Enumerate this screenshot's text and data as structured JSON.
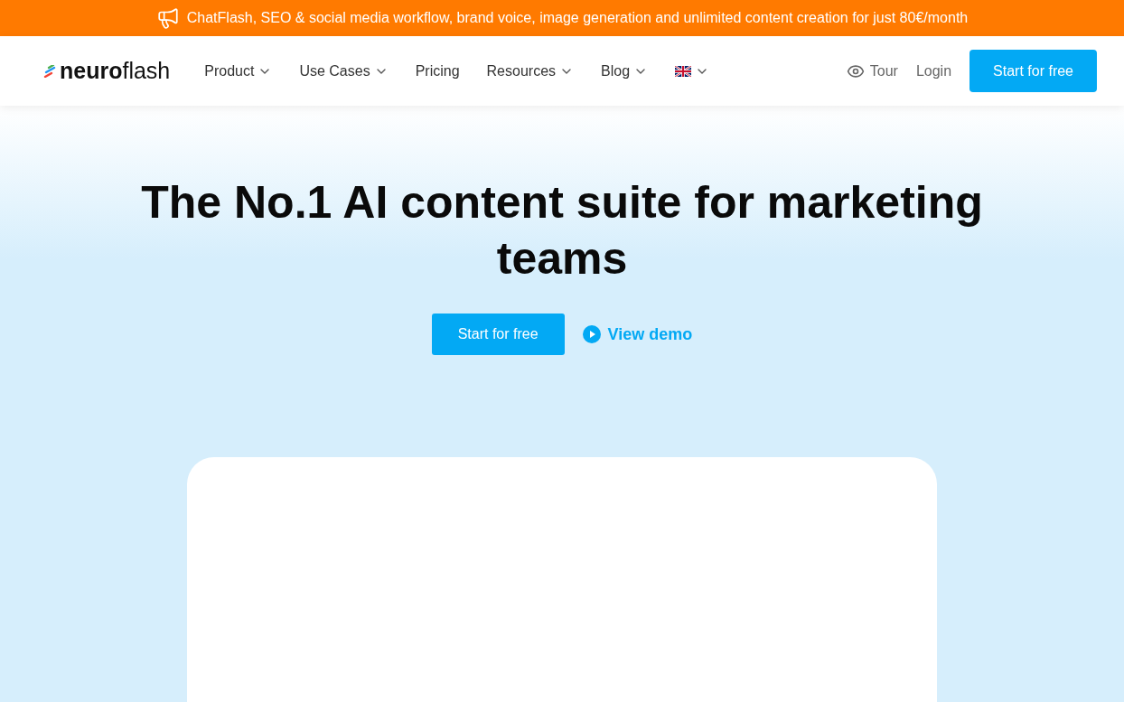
{
  "announcement": {
    "text": "ChatFlash, SEO & social media workflow, brand voice, image generation and unlimited content creation for just 80€/month"
  },
  "header": {
    "logo": "**neuro**flash",
    "nav": [
      {
        "kind": "link",
        "label": "Product",
        "has_caret": true
      },
      {
        "kind": "link",
        "label": "Use Cases",
        "has_caret": true
      },
      {
        "kind": "link",
        "label": "Pricing",
        "has_caret": false
      },
      {
        "kind": "link",
        "label": "Resources",
        "has_caret": true
      },
      {
        "kind": "link",
        "label": "Blog",
        "has_caret": true
      },
      {
        "kind": "flag",
        "has_caret": true
      }
    ],
    "tour": "Tour",
    "login": "Login",
    "cta": "Start for free"
  },
  "hero": {
    "title": "The No.1 AI content suite for marketing teams",
    "primary": "Start for free",
    "secondary": "View demo"
  }
}
